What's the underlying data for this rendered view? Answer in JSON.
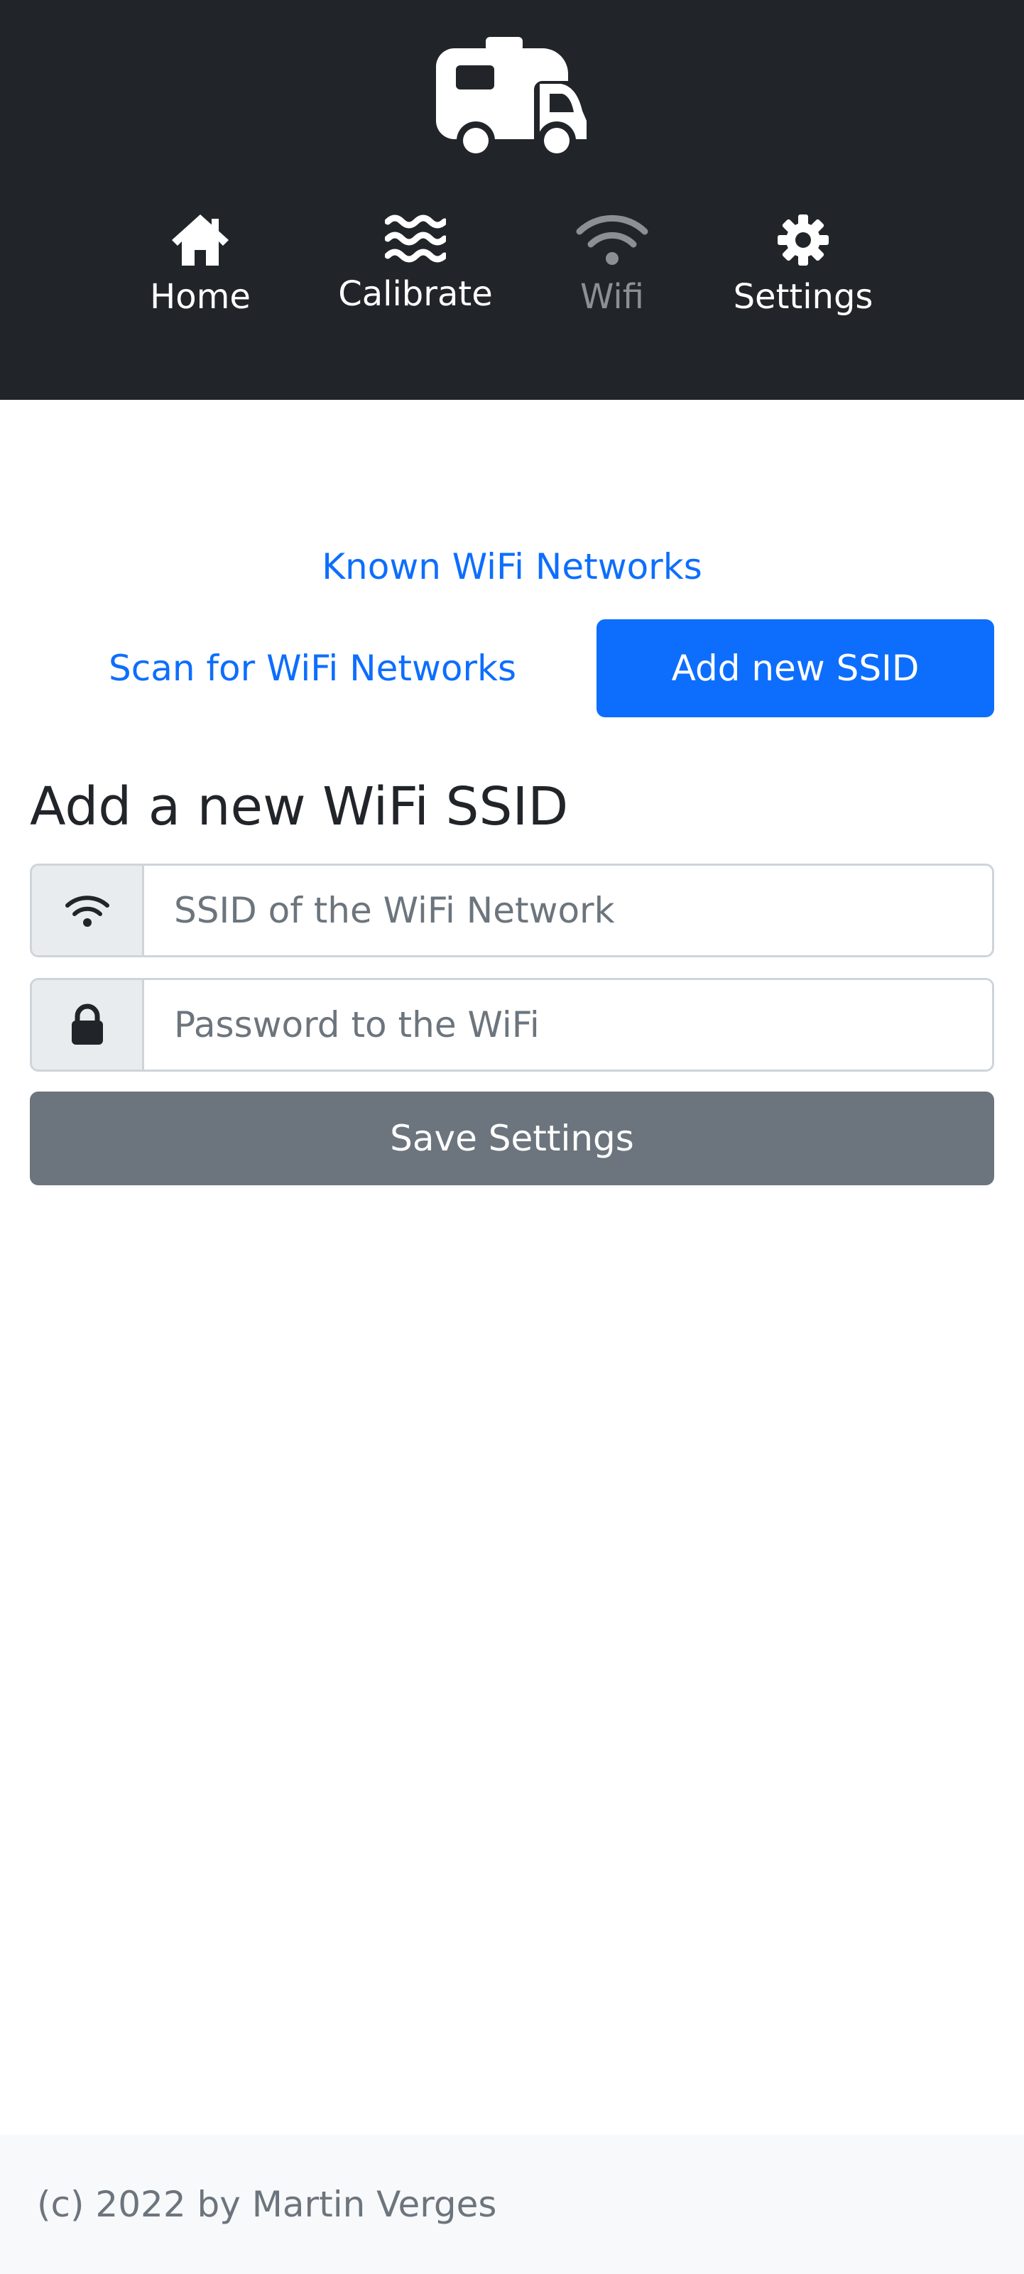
{
  "header": {
    "logo_icon": "caravan-icon",
    "nav": [
      {
        "label": "Home",
        "icon": "home-icon",
        "active": false
      },
      {
        "label": "Calibrate",
        "icon": "water-icon",
        "active": false
      },
      {
        "label": "Wifi",
        "icon": "wifi-icon",
        "active": true
      },
      {
        "label": "Settings",
        "icon": "gear-icon",
        "active": false
      }
    ]
  },
  "tabs": {
    "known": "Known WiFi Networks",
    "scan": "Scan for WiFi Networks",
    "add": "Add new SSID"
  },
  "form": {
    "title": "Add a new WiFi SSID",
    "ssid": {
      "placeholder": "SSID of the WiFi Network",
      "value": "",
      "icon": "wifi-icon"
    },
    "password": {
      "placeholder": "Password to the WiFi",
      "value": "",
      "icon": "lock-icon"
    },
    "save_label": "Save Settings"
  },
  "footer": {
    "text": "(c) 2022 by Martin Verges"
  },
  "colors": {
    "header_bg": "#212529",
    "primary": "#0d6efd",
    "secondary": "#6c757d",
    "footer_bg": "#f8f9fa"
  }
}
